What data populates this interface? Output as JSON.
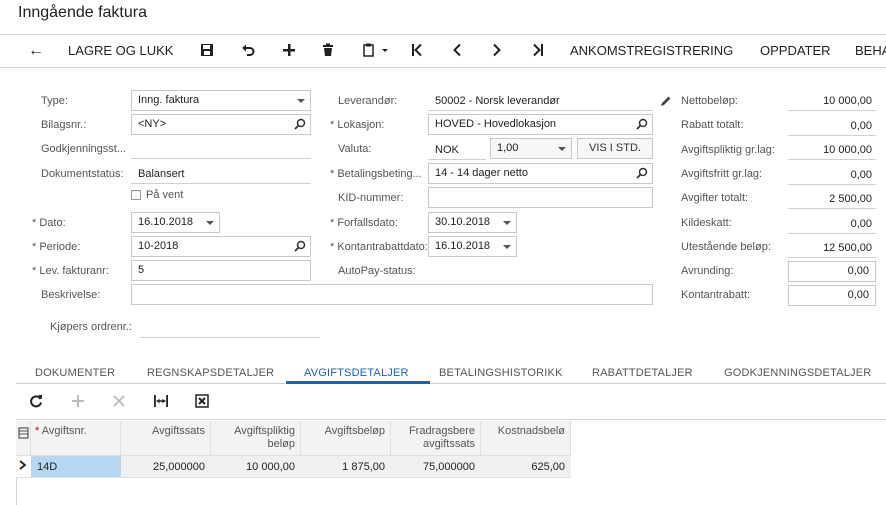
{
  "title": "Inngående faktura",
  "toolbar": {
    "back_label": "←",
    "save_close_label": "LAGRE OG LUKK",
    "arrival_label": "ANKOMSTREGISTRERING",
    "update_label": "OPPDATER",
    "more_label": "BEHA"
  },
  "form": {
    "type": {
      "label": "Type:",
      "value": "Inng. faktura"
    },
    "doc_no": {
      "label": "Bilagsnr.:",
      "value": "<NY>"
    },
    "approval": {
      "label": "Godkjenningsst..."
    },
    "doc_status": {
      "label": "Dokumentstatus:",
      "value": "Balansert"
    },
    "on_hold": {
      "label": "På vent"
    },
    "date": {
      "label": "Dato:",
      "value": "16.10.2018"
    },
    "period": {
      "label": "Periode:",
      "value": "10-2018"
    },
    "vendor_ref": {
      "label": "Lev. fakturanr:",
      "value": "5"
    },
    "description": {
      "label": "Beskrivelse:",
      "value": ""
    },
    "buyer_order": {
      "label": "Kjøpers ordrenr.:"
    },
    "vendor": {
      "label": "Leverandør:",
      "value": "50002 - Norsk leverandør"
    },
    "location": {
      "label": "Lokasjon:",
      "value": "HOVED - Hovedlokasjon"
    },
    "currency": {
      "label": "Valuta:",
      "value": "NOK",
      "rate": "1,00",
      "button": "VIS I STD."
    },
    "terms": {
      "label": "Betalingsbeting...",
      "value": "14 - 14 dager netto"
    },
    "kid": {
      "label": "KID-nummer:",
      "value": ""
    },
    "due_date": {
      "label": "Forfallsdato:",
      "value": "30.10.2018"
    },
    "cash_disc_date": {
      "label": "Kontantrabattdato:",
      "value": "16.10.2018"
    },
    "autopay": {
      "label": "AutoPay-status:"
    },
    "net_amount": {
      "label": "Nettobeløp:",
      "value": "10 000,00"
    },
    "discount_total": {
      "label": "Rabatt totalt:",
      "value": "0,00"
    },
    "taxable": {
      "label": "Avgiftspliktig gr.lag:",
      "value": "10 000,00"
    },
    "exempt": {
      "label": "Avgiftsfritt gr.lag:",
      "value": "0,00"
    },
    "tax_total": {
      "label": "Avgifter totalt:",
      "value": "2 500,00"
    },
    "withholding": {
      "label": "Kildeskatt:",
      "value": "0,00"
    },
    "balance": {
      "label": "Utestående beløp:",
      "value": "12 500,00"
    },
    "rounding": {
      "label": "Avrunding:",
      "value": "0,00"
    },
    "cash_discount": {
      "label": "Kontantrabatt:",
      "value": "0,00"
    }
  },
  "tabs": [
    "DOKUMENTER",
    "REGNSKAPSDETALJER",
    "AVGIFTSDETALJER",
    "BETALINGSHISTORIKK",
    "RABATTDETALJER",
    "GODKJENNINGSDETALJER"
  ],
  "grid": {
    "headers": [
      "Avgiftsnr.",
      "Avgiftssats",
      "Avgiftspliktig",
      "beløp",
      "Avgiftsbeløp",
      "Fradragsbere",
      "avgiftssats",
      "Kostnadsbelø"
    ],
    "row": [
      "14D",
      "25,000000",
      "10 000,00",
      "1 875,00",
      "75,000000",
      "625,00"
    ]
  },
  "colors": {
    "accent": "#1a62b5",
    "border": "#c8c8c8"
  }
}
